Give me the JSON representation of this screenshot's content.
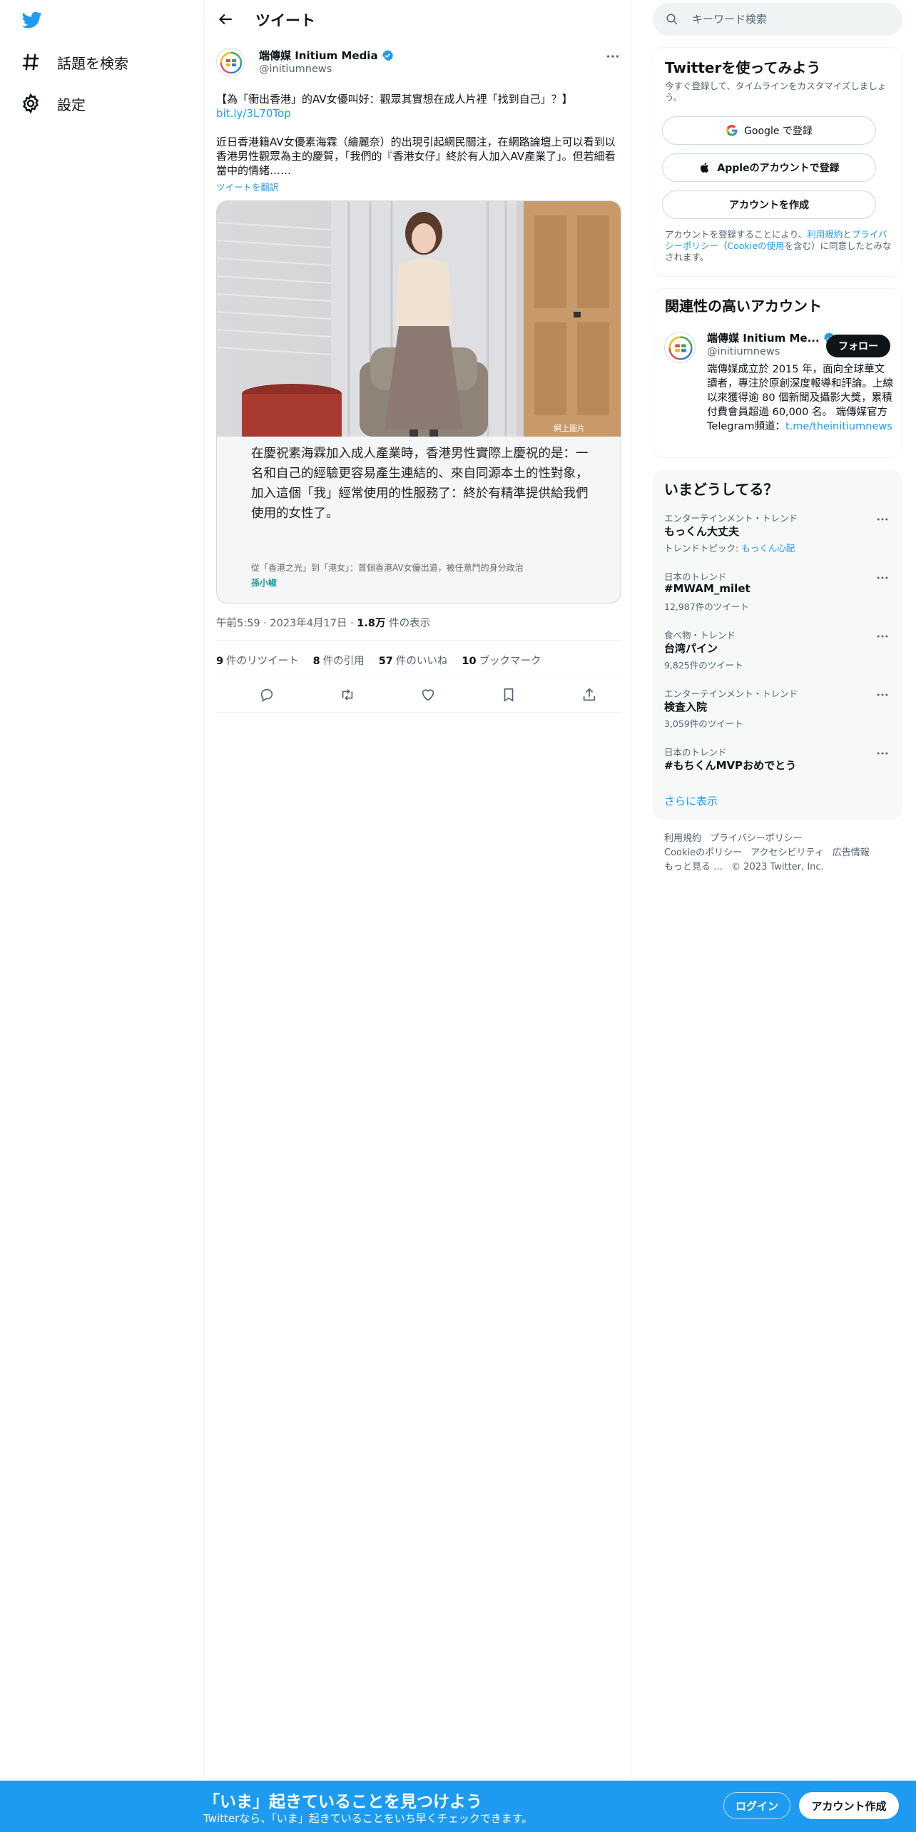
{
  "colors": {
    "brand": "#1d9bf0",
    "text": "#0f1419",
    "muted": "#536471",
    "follow_bg": "#0f1419"
  },
  "nav": {
    "items": [
      {
        "label": "話題を検索",
        "icon": "hashtag-icon"
      },
      {
        "label": "設定",
        "icon": "gear-icon"
      }
    ]
  },
  "header": {
    "title": "ツイート"
  },
  "tweet": {
    "author_name": "端傳媒 Initium Media",
    "author_handle": "@initiumnews",
    "text1_prefix": "【為「衝出香港」的AV女優叫好：觀眾其實想在成人片裡「找到自己」？】",
    "text1_link": "bit.ly/3L70Top",
    "text2": "近日香港籍AV女優素海霖（繪麗奈）的出現引起網民關注，在網路論壇上可以看到以香港男性觀眾為主的慶賀，「我們的『香港女仔』終於有人加入AV產業了」。但若細看當中的情緒……",
    "translate": "ツイートを翻訳",
    "card": {
      "image_caption": "網上圖片",
      "quote": "在慶祝素海霖加入成人產業時，香港男性實際上慶祝的是：一名和自己的經驗更容易產生連結的、來自同源本土的性對象，加入這個「我」經常使用的性服務了：終於有精準提供給我們使用的女性了。",
      "source": "從「香港之光」到「港女」：首個香港AV女優出道，被任意鬥的身分政治",
      "author": "孫小椒"
    },
    "time": "午前5:59",
    "date": "2023年4月17日",
    "views": "1.8万",
    "views_label": "件の表示",
    "stats": [
      {
        "n": "9",
        "label": "件のリツイート"
      },
      {
        "n": "8",
        "label": "件の引用"
      },
      {
        "n": "57",
        "label": "件のいいね"
      },
      {
        "n": "10",
        "label": "ブックマーク"
      }
    ]
  },
  "search": {
    "placeholder": "キーワード検索"
  },
  "signup_box": {
    "title": "Twitterを使ってみよう",
    "subtitle": "今すぐ登録して、タイムラインをカスタマイズしましょう。",
    "google": "Google で登録",
    "apple": "Appleのアカウントで登録",
    "create": "アカウントを作成",
    "terms_pre": "アカウントを登録することにより、",
    "terms_link1": "利用規約",
    "terms_mid": "と",
    "terms_link2": "プライバシーポリシー",
    "terms_paren_open": "（",
    "terms_link3": "Cookieの使用",
    "terms_post": "を含む）に同意したとみなされます。"
  },
  "relevant": {
    "title": "関連性の高いアカウント",
    "name": "端傳媒 Initium Me...",
    "handle": "@initiumnews",
    "follow": "フォロー",
    "bio": "端傳媒成立於 2015 年，面向全球華文讀者，專注於原創深度報導和評論。上線以來獲得逾 80 個新聞及攝影大獎，累積付費會員超過 60,000 名。 端傳媒官方Telegram頻道：",
    "bio_link": "t.me/theinitiumnews"
  },
  "trends": {
    "title": "いまどうしてる？",
    "items": [
      {
        "category": "エンターテインメント・トレンド",
        "name": "もっくん大丈夫",
        "sub_pre": "トレンドトピック: ",
        "sub_link": "もっくん心配"
      },
      {
        "category": "日本のトレンド",
        "name": "#MWAM_milet",
        "sub": "12,987件のツイート"
      },
      {
        "category": "食べ物・トレンド",
        "name": "台湾パイン",
        "sub": "9,825件のツイート"
      },
      {
        "category": "エンターテインメント・トレンド",
        "name": "検査入院",
        "sub": "3,059件のツイート"
      },
      {
        "category": "日本のトレンド",
        "name": "#もちくんMVPおめでとう"
      }
    ],
    "show_more": "さらに表示"
  },
  "footer": {
    "links": [
      "利用規約",
      "プライバシーポリシー",
      "Cookieのポリシー",
      "アクセシビリティ",
      "広告情報",
      "もっと見る …"
    ],
    "copyright": "© 2023 Twitter, Inc."
  },
  "banner": {
    "title": "「いま」起きていることを見つけよう",
    "subtitle": "Twitterなら、「いま」起きていることをいち早くチェックできます。",
    "login": "ログイン",
    "signup": "アカウント作成"
  }
}
